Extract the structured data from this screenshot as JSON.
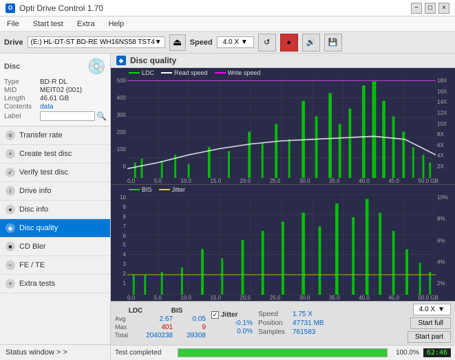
{
  "titleBar": {
    "appName": "Opti Drive Control 1.70",
    "controls": [
      "−",
      "□",
      "×"
    ]
  },
  "menuBar": {
    "items": [
      "File",
      "Start test",
      "Extra",
      "Help"
    ]
  },
  "driveBar": {
    "label": "Drive",
    "driveValue": "(E:)  HL-DT-ST BD-RE  WH16NS58 TST4",
    "speedLabel": "Speed",
    "speedValue": "4.0 X"
  },
  "sidebar": {
    "discInfo": {
      "type": {
        "label": "Type",
        "value": "BD-R DL"
      },
      "mid": {
        "label": "MID",
        "value": "MEIT02 (001)"
      },
      "length": {
        "label": "Length",
        "value": "46.61 GB"
      },
      "contents": {
        "label": "Contents",
        "value": "data"
      },
      "labelField": {
        "label": "Label",
        "placeholder": ""
      }
    },
    "navItems": [
      {
        "id": "transfer-rate",
        "label": "Transfer rate",
        "icon": "≡"
      },
      {
        "id": "create-test-disc",
        "label": "Create test disc",
        "icon": "+"
      },
      {
        "id": "verify-test-disc",
        "label": "Verify test disc",
        "icon": "✓"
      },
      {
        "id": "drive-info",
        "label": "Drive info",
        "icon": "i"
      },
      {
        "id": "disc-info",
        "label": "Disc info",
        "icon": "●"
      },
      {
        "id": "disc-quality",
        "label": "Disc quality",
        "icon": "◆",
        "active": true
      },
      {
        "id": "cd-bler",
        "label": "CD Bler",
        "icon": "■"
      },
      {
        "id": "fe-te",
        "label": "FE / TE",
        "icon": "~"
      },
      {
        "id": "extra-tests",
        "label": "Extra tests",
        "icon": "+"
      }
    ],
    "statusWindow": "Status window > >"
  },
  "discQuality": {
    "title": "Disc quality",
    "topChart": {
      "legend": [
        {
          "label": "LDC",
          "color": "#00ff00"
        },
        {
          "label": "Read speed",
          "color": "#ffffff"
        },
        {
          "label": "Write speed",
          "color": "#ff00ff"
        }
      ],
      "yAxisLeft": [
        "500",
        "400",
        "300",
        "200",
        "100",
        "0"
      ],
      "yAxisRight": [
        "18X",
        "16X",
        "14X",
        "12X",
        "10X",
        "8X",
        "6X",
        "4X",
        "2X"
      ],
      "xAxis": [
        "0.0",
        "5.0",
        "10.0",
        "15.0",
        "20.0",
        "25.0",
        "30.0",
        "35.0",
        "40.0",
        "45.0",
        "50.0 GB"
      ]
    },
    "bottomChart": {
      "legend": [
        {
          "label": "BIS",
          "color": "#00ff00"
        },
        {
          "label": "Jitter",
          "color": "#ffff00"
        }
      ],
      "yAxisLeft": [
        "10",
        "9",
        "8",
        "7",
        "6",
        "5",
        "4",
        "3",
        "2",
        "1"
      ],
      "yAxisRight": [
        "10%",
        "8%",
        "6%",
        "4%",
        "2%"
      ],
      "xAxis": [
        "0.0",
        "5.0",
        "10.0",
        "15.0",
        "20.0",
        "25.0",
        "30.0",
        "35.0",
        "40.0",
        "45.0",
        "50.0 GB"
      ]
    }
  },
  "stats": {
    "columns": [
      "LDC",
      "BIS",
      "Jitter"
    ],
    "rows": [
      {
        "label": "Avg",
        "ldc": "2.67",
        "bis": "0.05",
        "jitter": "-0.1%"
      },
      {
        "label": "Max",
        "ldc": "401",
        "bis": "9",
        "jitter": "0.0%"
      },
      {
        "label": "Total",
        "ldc": "2040238",
        "bis": "39308",
        "jitter": ""
      }
    ],
    "jitterChecked": true,
    "speed": {
      "speedLabel": "Speed",
      "speedValue": "1.75 X",
      "posLabel": "Position",
      "posValue": "47731 MB",
      "samplesLabel": "Samples",
      "samplesValue": "761583"
    },
    "speedSelect": "4.0 X",
    "buttons": [
      "Start full",
      "Start part"
    ]
  },
  "progressBar": {
    "label": "Test completed",
    "percent": 100,
    "displayPercent": "100.0%",
    "time": "62:46"
  }
}
